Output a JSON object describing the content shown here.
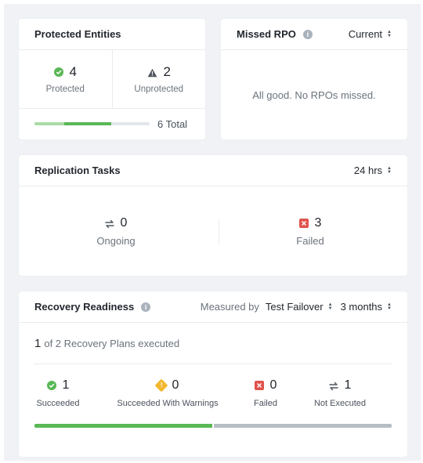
{
  "colors": {
    "success": "#5ab856",
    "error": "#e0534c",
    "warning": "#f2b830",
    "neutral": "#b8bec5",
    "accent": "#5ab856"
  },
  "protected_entities": {
    "title": "Protected Entities",
    "protected": {
      "count": "4",
      "label": "Protected",
      "icon": "check-circle-icon"
    },
    "unprotected": {
      "count": "2",
      "label": "Unprotected",
      "icon": "warning-triangle-icon"
    },
    "total_label": "6 Total",
    "progress_fraction": 0.67
  },
  "missed_rpo": {
    "title": "Missed RPO",
    "filter_value": "Current",
    "empty_message": "All good. No RPOs missed."
  },
  "replication_tasks": {
    "title": "Replication Tasks",
    "range_value": "24 hrs",
    "ongoing": {
      "count": "0",
      "label": "Ongoing",
      "icon": "sync-arrows-icon"
    },
    "failed": {
      "count": "3",
      "label": "Failed",
      "icon": "error-x-icon"
    }
  },
  "recovery_readiness": {
    "title": "Recovery Readiness",
    "measured_by_label": "Measured by",
    "measured_by_value": "Test Failover",
    "range_value": "3 months",
    "executed_count": "1",
    "executed_text": "of 2 Recovery Plans executed",
    "stats": [
      {
        "count": "1",
        "label": "Succeeded",
        "icon": "check-circle-icon"
      },
      {
        "count": "0",
        "label": "Succeeded With Warnings",
        "icon": "warning-diamond-icon"
      },
      {
        "count": "0",
        "label": "Failed",
        "icon": "error-x-icon"
      },
      {
        "count": "1",
        "label": "Not Executed",
        "icon": "sync-arrows-icon"
      }
    ],
    "progress_fraction": 0.5
  }
}
